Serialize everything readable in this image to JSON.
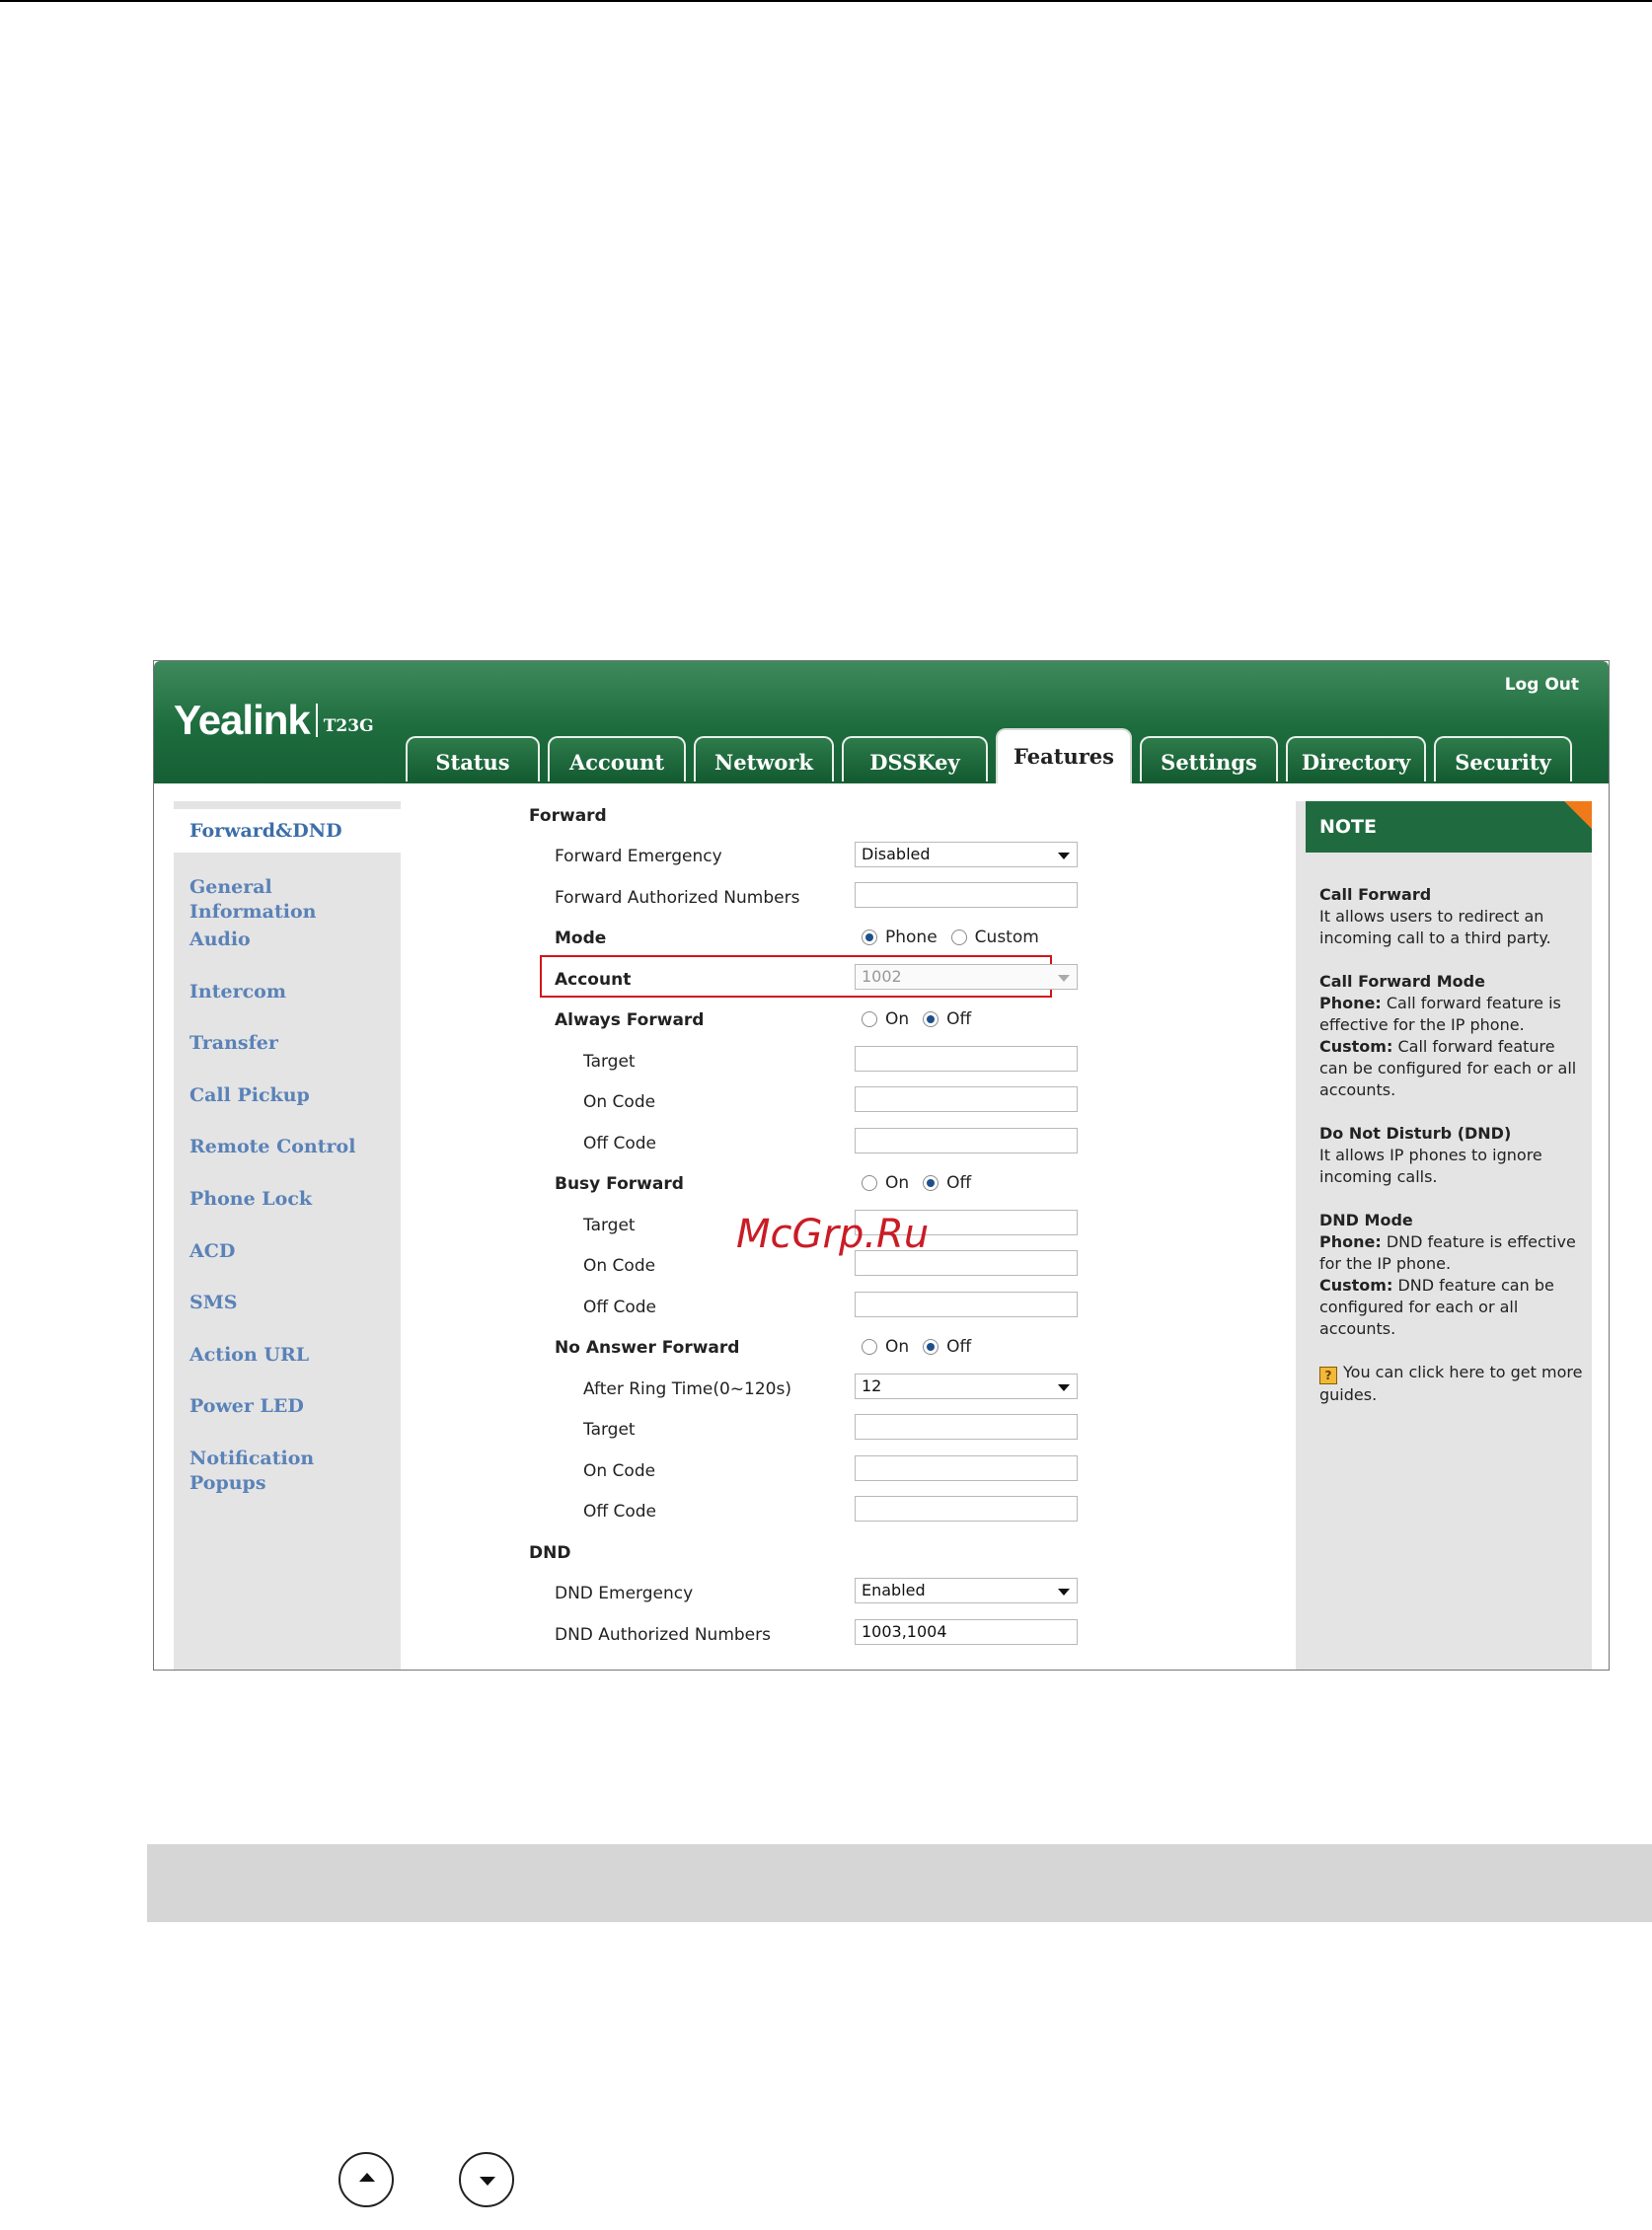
{
  "header": {
    "logo_text": "Yealink",
    "model": "T23G",
    "logout_label": "Log Out"
  },
  "tabs": [
    "Status",
    "Account",
    "Network",
    "DSSKey",
    "Features",
    "Settings",
    "Directory",
    "Security"
  ],
  "active_tab": "Features",
  "sidebar": {
    "items": [
      "Forward&DND",
      "General Information",
      "Audio",
      "Intercom",
      "Transfer",
      "Call Pickup",
      "Remote Control",
      "Phone Lock",
      "ACD",
      "SMS",
      "Action URL",
      "Power LED",
      "Notification Popups"
    ],
    "general_line1": "General",
    "general_line2": "Information"
  },
  "form": {
    "forward_section": "Forward",
    "forward_emergency_label": "Forward Emergency",
    "forward_emergency_value": "Disabled",
    "forward_authorized_label": "Forward Authorized Numbers",
    "forward_authorized_value": "",
    "mode_label": "Mode",
    "mode_option_phone": "Phone",
    "mode_option_custom": "Custom",
    "mode_selected": "Phone",
    "account_label": "Account",
    "account_value": "1002",
    "always_forward_label": "Always Forward",
    "busy_forward_label": "Busy Forward",
    "no_answer_forward_label": "No Answer Forward",
    "on_label": "On",
    "off_label": "Off",
    "target_label": "Target",
    "on_code_label": "On Code",
    "off_code_label": "Off Code",
    "after_ring_time_label": "After Ring Time(0~120s)",
    "after_ring_time_value": "12",
    "dnd_section": "DND",
    "dnd_emergency_label": "DND Emergency",
    "dnd_emergency_value": "Enabled",
    "dnd_authorized_label": "DND Authorized Numbers",
    "dnd_authorized_value": "1003,1004"
  },
  "note": {
    "title": "NOTE",
    "call_forward_title": "Call Forward",
    "call_forward_text": "It allows users to redirect an incoming call to a third party.",
    "mode_title": "Call Forward Mode",
    "mode_phone_key": "Phone:",
    "mode_phone_text": " Call forward feature is effective for the IP phone.",
    "mode_custom_key": "Custom:",
    "mode_custom_text": " Call forward feature can be configured for each or all accounts.",
    "dnd_title": "Do Not Disturb (DND)",
    "dnd_text": "It allows IP phones to ignore incoming calls.",
    "dnd_mode_title": "DND Mode",
    "dnd_phone_key": "Phone:",
    "dnd_phone_text": " DND feature is effective for the IP phone.",
    "dnd_custom_key": "Custom:",
    "dnd_custom_text": " DND feature can be configured for each or all accounts.",
    "guide_text": "You can click here to get more guides."
  },
  "watermark": "McGrp.Ru",
  "colors": {
    "header_green": "#1d6c3e",
    "sidebar_link": "#5a82b8",
    "highlight_box": "#d0161c",
    "note_corner": "#f07a1a"
  }
}
